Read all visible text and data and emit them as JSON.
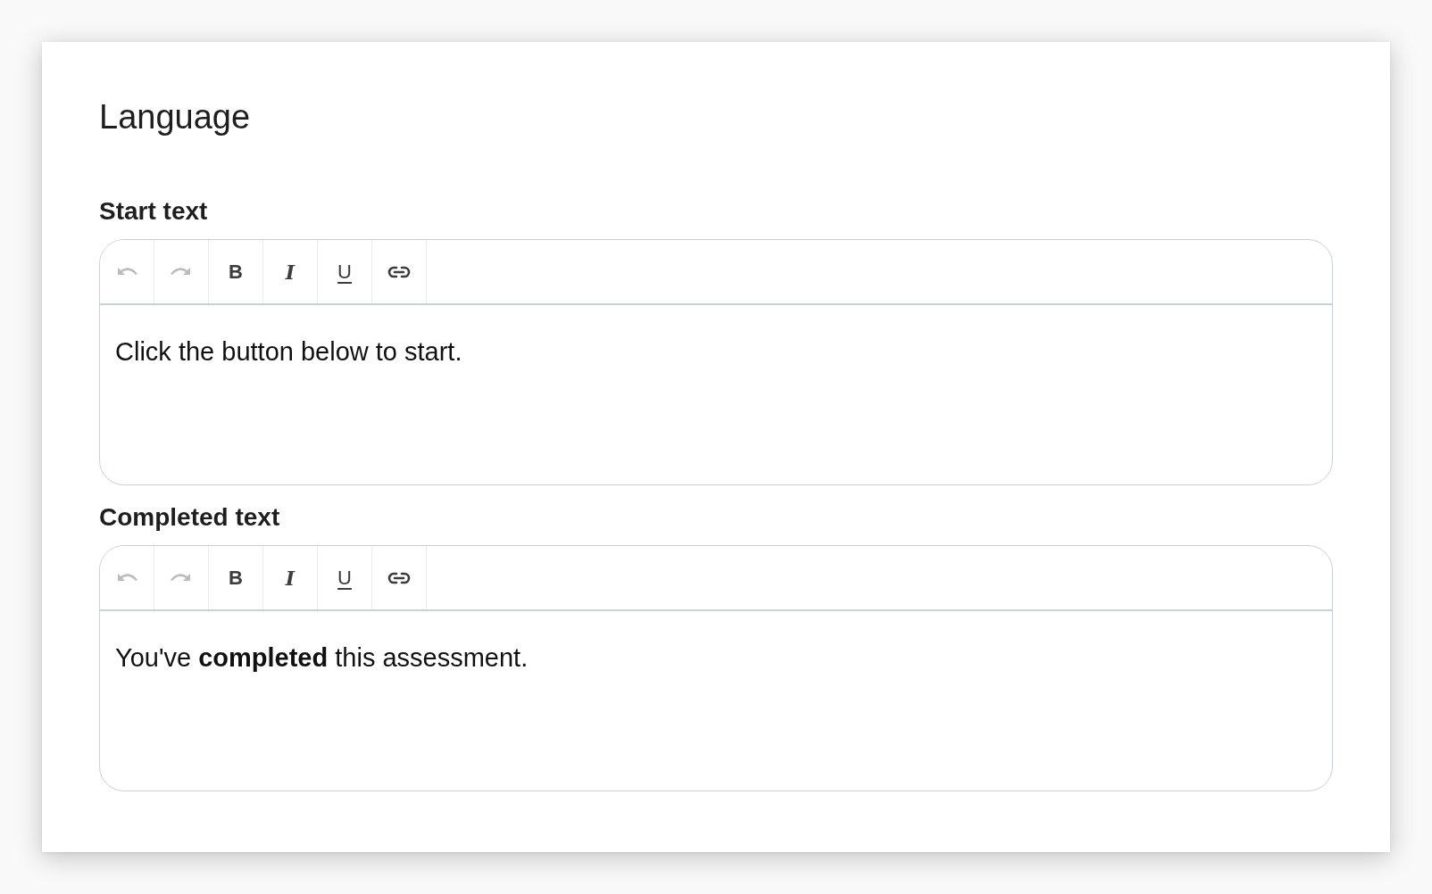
{
  "title": "Language",
  "editors": [
    {
      "label": "Start text",
      "toolbar": [
        {
          "kind": "undo",
          "disabled": true
        },
        {
          "kind": "redo",
          "disabled": true
        },
        {
          "kind": "bold",
          "label": "B",
          "disabled": false
        },
        {
          "kind": "italic",
          "label": "I",
          "disabled": false
        },
        {
          "kind": "underline",
          "label": "U",
          "disabled": false
        },
        {
          "kind": "link",
          "disabled": false
        }
      ],
      "content": "Click the button below to start."
    },
    {
      "label": "Completed text",
      "toolbar": [
        {
          "kind": "undo",
          "disabled": true
        },
        {
          "kind": "redo",
          "disabled": true
        },
        {
          "kind": "bold",
          "label": "B",
          "disabled": false
        },
        {
          "kind": "italic",
          "label": "I",
          "disabled": false
        },
        {
          "kind": "underline",
          "label": "U",
          "disabled": false
        },
        {
          "kind": "link",
          "disabled": false
        }
      ],
      "content": "You've **completed** this assessment."
    }
  ]
}
